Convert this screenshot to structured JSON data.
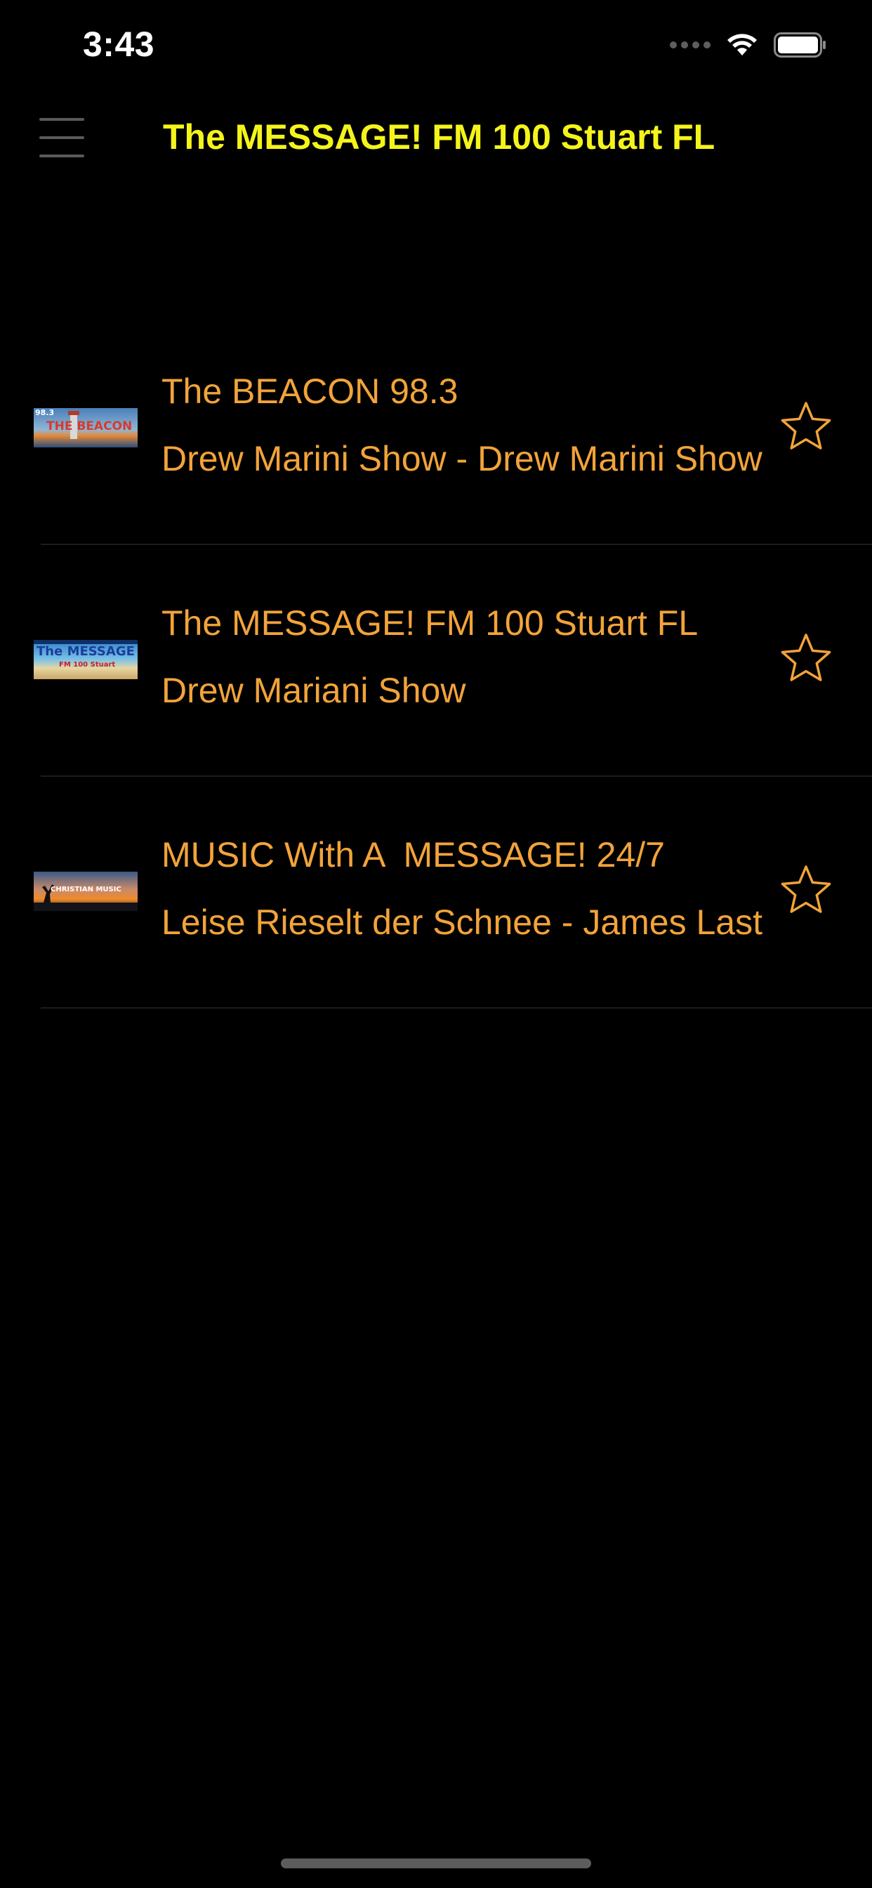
{
  "status_bar": {
    "time": "3:43"
  },
  "header": {
    "title": "The MESSAGE! FM 100 Stuart FL"
  },
  "stations": [
    {
      "name": "The BEACON 98.3",
      "song": "Drew Marini Show - Drew Marini Show",
      "logo_text": "THE BEACON",
      "logo_badge": "98.3"
    },
    {
      "name": "The MESSAGE! FM 100 Stuart FL",
      "song": "Drew Mariani Show",
      "logo_text": "The MESSAGE",
      "logo_badge": "FM 100 Stuart"
    },
    {
      "name": "MUSIC With A  MESSAGE! 24/7",
      "song": "Leise Rieselt der Schnee - James Last",
      "logo_text": "CHRISTIAN MUSIC"
    }
  ],
  "icons": {
    "menu": "hamburger-menu-icon",
    "favorite": "star-outline-icon",
    "wifi": "wifi-icon",
    "battery": "battery-icon"
  },
  "colors": {
    "background": "#000000",
    "title": "#F4F41A",
    "accent": "#F2A33A"
  }
}
